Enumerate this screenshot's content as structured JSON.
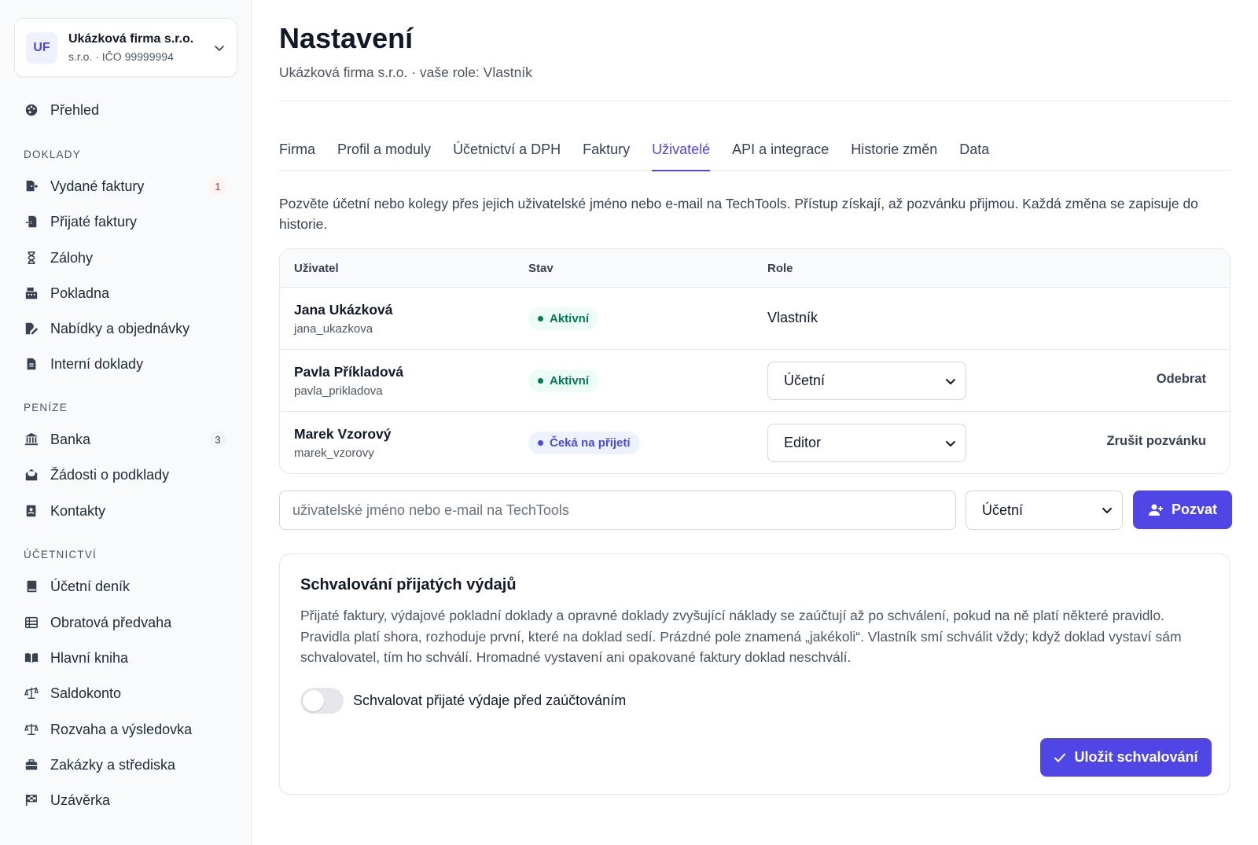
{
  "company": {
    "initials": "UF",
    "name": "Ukázková firma s.r.o.",
    "meta": "s.r.o. · IČO 99999994"
  },
  "sidebar": {
    "overview": {
      "label": "Přehled",
      "icon": "palette-icon"
    },
    "sections": [
      {
        "label": "DOKLADY",
        "items": [
          {
            "label": "Vydané faktury",
            "icon": "file-export-icon",
            "badge": "1"
          },
          {
            "label": "Přijaté faktury",
            "icon": "file-import-icon"
          },
          {
            "label": "Zálohy",
            "icon": "hourglass-icon"
          },
          {
            "label": "Pokladna",
            "icon": "cash-register-icon"
          },
          {
            "label": "Nabídky a objednávky",
            "icon": "file-signature-icon"
          },
          {
            "label": "Interní doklady",
            "icon": "file-icon"
          }
        ]
      },
      {
        "label": "PENÍZE",
        "items": [
          {
            "label": "Banka",
            "icon": "bank-icon",
            "badge": "3"
          },
          {
            "label": "Žádosti o podklady",
            "icon": "envelope-open-icon"
          },
          {
            "label": "Kontakty",
            "icon": "address-book-icon"
          }
        ]
      },
      {
        "label": "ÚČETNICTVÍ",
        "items": [
          {
            "label": "Účetní deník",
            "icon": "book-icon"
          },
          {
            "label": "Obratová předvaha",
            "icon": "table-list-icon"
          },
          {
            "label": "Hlavní kniha",
            "icon": "book-open-icon"
          },
          {
            "label": "Saldokonto",
            "icon": "scale-unbalanced-icon"
          },
          {
            "label": "Rozvaha a výsledovka",
            "icon": "scale-balanced-icon"
          },
          {
            "label": "Zakázky a střediska",
            "icon": "briefcase-icon"
          },
          {
            "label": "Uzávěrka",
            "icon": "flag-checkered-icon"
          }
        ]
      }
    ]
  },
  "page": {
    "title": "Nastavení",
    "subtitle": "Ukázková firma s.r.o. · vaše role: Vlastník"
  },
  "tabs": [
    {
      "label": "Firma"
    },
    {
      "label": "Profil a moduly"
    },
    {
      "label": "Účetnictví a DPH"
    },
    {
      "label": "Faktury"
    },
    {
      "label": "Uživatelé",
      "active": true
    },
    {
      "label": "API a integrace"
    },
    {
      "label": "Historie změn"
    },
    {
      "label": "Data"
    }
  ],
  "intro": "Pozvěte účetní nebo kolegy přes jejich uživatelské jméno nebo e-mail na TechTools. Přístup získají, až pozvánku přijmou. Každá změna se zapisuje do historie.",
  "users_table": {
    "headers": {
      "user": "Uživatel",
      "status": "Stav",
      "role": "Role"
    },
    "rows": [
      {
        "name": "Jana Ukázková",
        "login": "jana_ukazkova",
        "status": "Aktivní",
        "status_kind": "active",
        "role": "Vlastník",
        "role_editable": false,
        "action": ""
      },
      {
        "name": "Pavla Příkladová",
        "login": "pavla_prikladova",
        "status": "Aktivní",
        "status_kind": "active",
        "role": "Účetní",
        "role_editable": true,
        "action": "Odebrat"
      },
      {
        "name": "Marek Vzorový",
        "login": "marek_vzorovy",
        "status": "Čeká na přijetí",
        "status_kind": "pending",
        "role": "Editor",
        "role_editable": true,
        "action": "Zrušit pozvánku"
      }
    ]
  },
  "invite": {
    "placeholder": "uživatelské jméno nebo e-mail na TechTools",
    "role": "Účetní",
    "button": "Pozvat"
  },
  "approval": {
    "title": "Schvalování přijatých výdajů",
    "description": "Přijaté faktury, výdajové pokladní doklady a opravné doklady zvyšující náklady se zaúčtují až po schválení, pokud na ně platí některé pravidlo. Pravidla platí shora, rozhoduje první, které na doklad sedí. Prázdné pole znamená „jakékoli“. Vlastník smí schválit vždy; když doklad vystaví sám schvalovatel, tím ho schválí. Hromadné vystavení ani opakované faktury doklad neschválí.",
    "toggle_label": "Schvalovat přijaté výdaje před zaúčtováním",
    "toggle_on": false,
    "save_button": "Uložit schvalování"
  },
  "colors": {
    "accent": "#4f46e5",
    "active_status": "#047857",
    "badge_red": "#dc2626"
  }
}
